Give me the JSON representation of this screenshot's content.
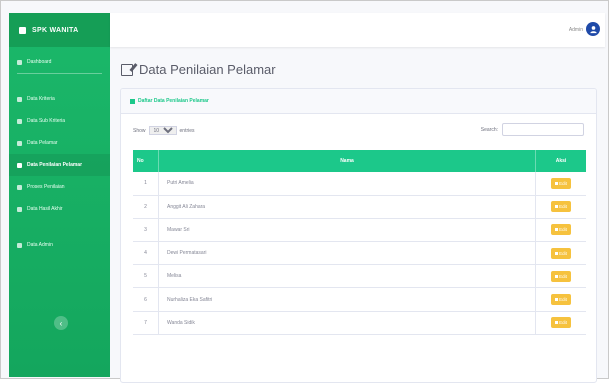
{
  "brand": "SPK WANITA",
  "sidebar": {
    "items": [
      {
        "label": "Dashboard",
        "active": false
      },
      {
        "label": "Data Kriteria",
        "active": false
      },
      {
        "label": "Data Sub Kriteria",
        "active": false
      },
      {
        "label": "Data Pelamar",
        "active": false
      },
      {
        "label": "Data Penilaian Pelamar",
        "active": true
      },
      {
        "label": "Proses Penilaian",
        "active": false
      },
      {
        "label": "Data Hasil Akhir",
        "active": false
      },
      {
        "label": "Data Admin",
        "active": false
      }
    ],
    "toggle_symbol": "‹"
  },
  "topbar": {
    "user_name": "Admin",
    "avatar_icon": "user-icon"
  },
  "page": {
    "title": "Data Penilaian Pelamar"
  },
  "card": {
    "header": "Daftar Data Penilaian Pelamar"
  },
  "controls": {
    "show_label": "Show",
    "show_value": "10",
    "entries_label": "entries",
    "search_label": "Search:"
  },
  "table": {
    "headers": {
      "no": "No",
      "nama": "Nama",
      "aksi": "Aksi"
    },
    "rows": [
      {
        "no": "1",
        "nama": "Putri Amelia"
      },
      {
        "no": "2",
        "nama": "Anggit Ali Zahara"
      },
      {
        "no": "3",
        "nama": "Mawar Sri"
      },
      {
        "no": "4",
        "nama": "Dewi Permatasari"
      },
      {
        "no": "5",
        "nama": "Melisa"
      },
      {
        "no": "6",
        "nama": "Nurhaliza Eka Safitri"
      },
      {
        "no": "7",
        "nama": "Wanda Sidik"
      }
    ],
    "edit_label": "Edit"
  },
  "colors": {
    "sidebar": "#1bb86a",
    "accent": "#1cc88a",
    "edit": "#f6c23e",
    "avatar": "#1f4aa8"
  }
}
